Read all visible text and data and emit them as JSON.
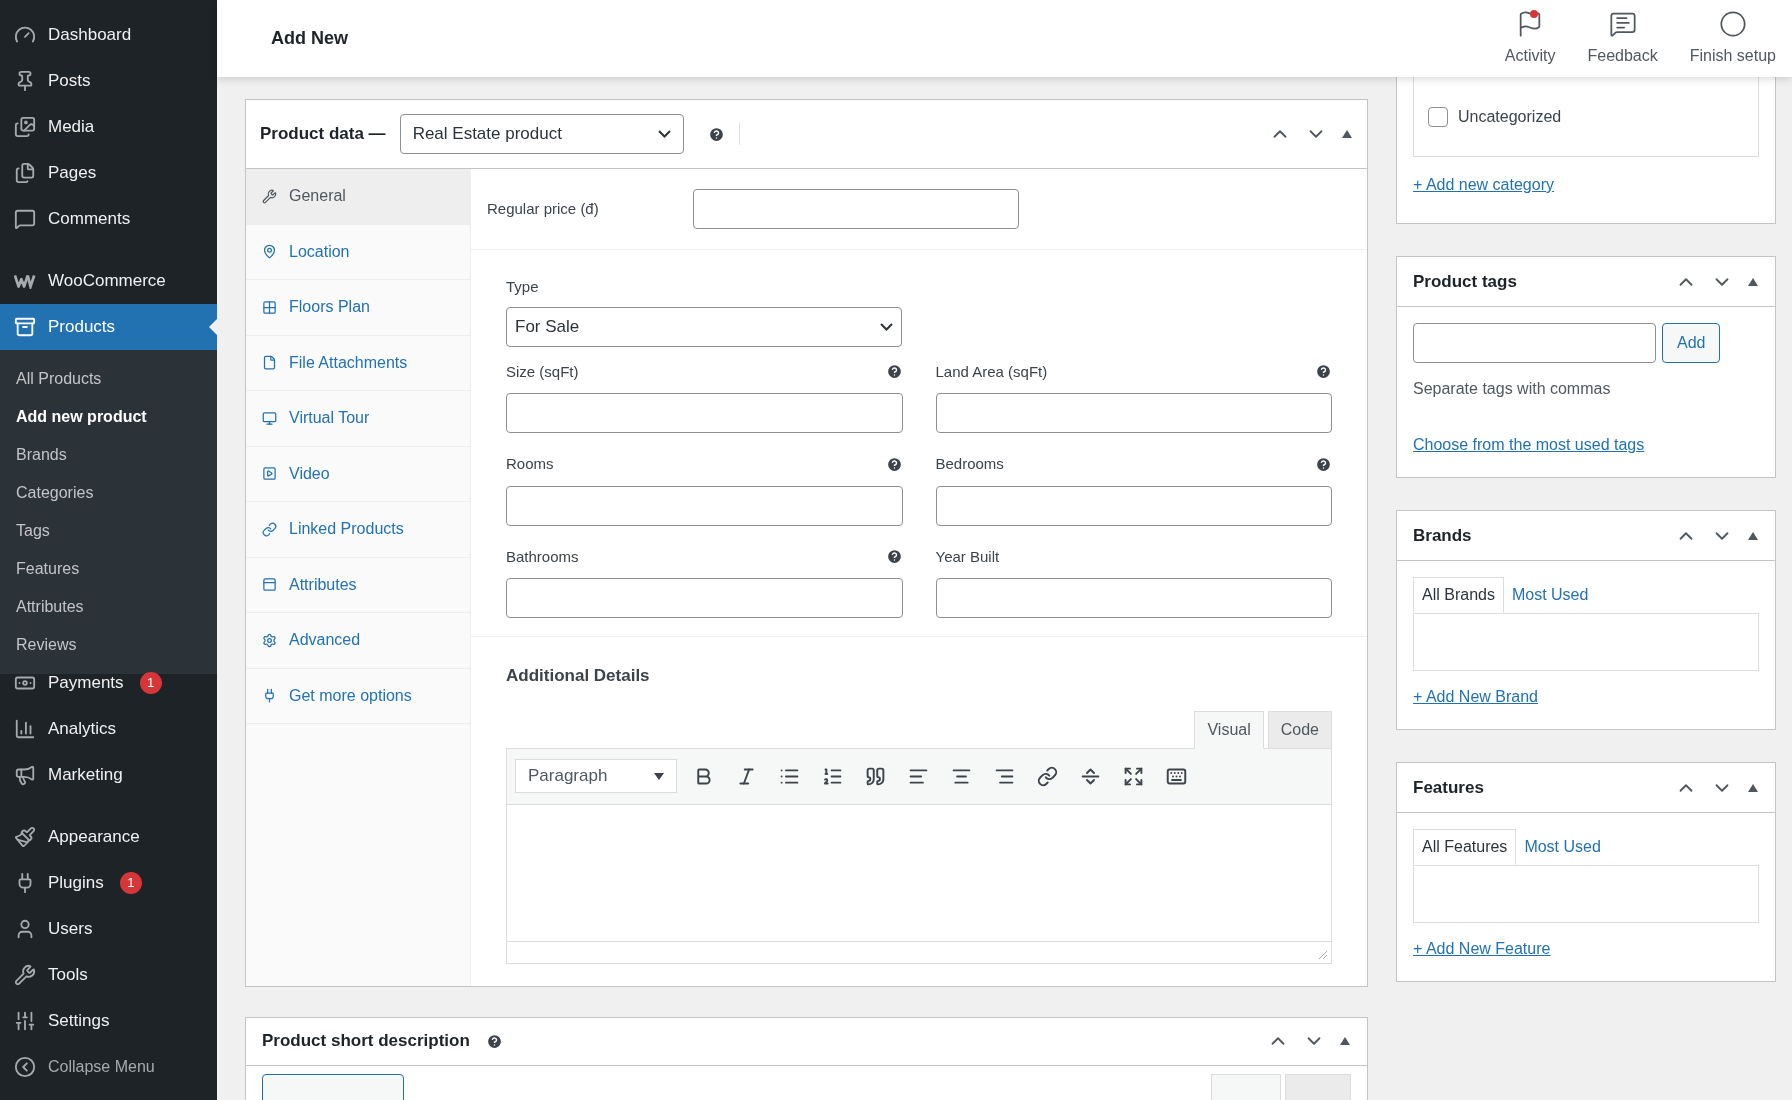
{
  "sidebar": {
    "groups": [
      [
        {
          "label": "Dashboard",
          "selected": false
        },
        {
          "label": "Posts",
          "selected": false
        },
        {
          "label": "Media",
          "selected": false
        },
        {
          "label": "Pages",
          "selected": false
        },
        {
          "label": "Comments",
          "selected": false
        }
      ],
      [
        {
          "label": "WooCommerce",
          "selected": false
        },
        {
          "label": "Products",
          "selected": true,
          "expanded": true,
          "children": [
            {
              "label": "All Products",
              "selected": false
            },
            {
              "label": "Add new product",
              "selected": true
            },
            {
              "label": "Brands",
              "selected": false
            },
            {
              "label": "Categories",
              "selected": false
            },
            {
              "label": "Tags",
              "selected": false
            },
            {
              "label": "Features",
              "selected": false
            },
            {
              "label": "Attributes",
              "selected": false
            },
            {
              "label": "Reviews",
              "selected": false
            }
          ]
        },
        {
          "label": "Payments",
          "selected": false,
          "badge": "1"
        },
        {
          "label": "Analytics",
          "selected": false
        },
        {
          "label": "Marketing",
          "selected": false
        }
      ],
      [
        {
          "label": "Appearance",
          "selected": false
        },
        {
          "label": "Plugins",
          "selected": false,
          "badge": "1"
        },
        {
          "label": "Users",
          "selected": false
        },
        {
          "label": "Tools",
          "selected": false
        },
        {
          "label": "Settings",
          "selected": false
        },
        {
          "label": "Collapse Menu",
          "selected": false
        }
      ]
    ]
  },
  "header": {
    "title": "Add New",
    "actions": [
      {
        "label": "Activity",
        "unread": true
      },
      {
        "label": "Feedback",
        "unread": false
      },
      {
        "label": "Finish setup",
        "unread": false
      }
    ]
  },
  "product_data": {
    "title": "Product data —",
    "product_type": "Real Estate product",
    "tabs": [
      {
        "label": "General",
        "selected": true
      },
      {
        "label": "Location",
        "selected": false
      },
      {
        "label": "Floors Plan",
        "selected": false
      },
      {
        "label": "File Attachments",
        "selected": false
      },
      {
        "label": "Virtual Tour",
        "selected": false
      },
      {
        "label": "Video",
        "selected": false
      },
      {
        "label": "Linked Products",
        "selected": false
      },
      {
        "label": "Attributes",
        "selected": false
      },
      {
        "label": "Advanced",
        "selected": false
      },
      {
        "label": "Get more options",
        "selected": false
      }
    ],
    "regular_price_label": "Regular price (đ)",
    "type": {
      "label": "Type",
      "value": "For Sale"
    },
    "fields": [
      {
        "label": "Size (sqFt)",
        "help": true
      },
      {
        "label": "Land Area (sqFt)",
        "help": true
      },
      {
        "label": "Rooms",
        "help": true
      },
      {
        "label": "Bedrooms",
        "help": true
      },
      {
        "label": "Bathrooms",
        "help": true
      },
      {
        "label": "Year Built",
        "help": false
      }
    ],
    "additional_details": {
      "title": "Additional Details",
      "editor_tabs": [
        {
          "label": "Visual",
          "selected": true
        },
        {
          "label": "Code",
          "selected": false
        }
      ],
      "format": "Paragraph"
    }
  },
  "short_description": {
    "title": "Product short description"
  },
  "categories": {
    "items": [
      {
        "label": "Uncategorized",
        "checked": false
      }
    ],
    "link": "+ Add new category"
  },
  "product_tags": {
    "title": "Product tags",
    "button": "Add",
    "hint": "Separate tags with commas",
    "link": "Choose from the most used tags"
  },
  "brands": {
    "title": "Brands",
    "tabs": [
      {
        "label": "All Brands",
        "selected": true
      },
      {
        "label": "Most Used",
        "selected": false
      }
    ],
    "link": "+ Add New Brand"
  },
  "features": {
    "title": "Features",
    "tabs": [
      {
        "label": "All Features",
        "selected": true
      },
      {
        "label": "Most Used",
        "selected": false
      }
    ],
    "link": "+ Add New Feature"
  }
}
